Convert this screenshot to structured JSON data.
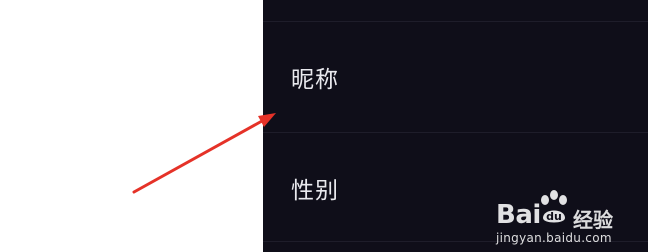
{
  "settings": {
    "rows": [
      {
        "label": "昵称"
      },
      {
        "label": "性别"
      }
    ]
  },
  "watermark": {
    "brand_left": "Bai",
    "brand_right": "du",
    "brand_cn": "经验",
    "url": "jingyan.baidu.com"
  },
  "annotation": {
    "arrow_color": "#e53228"
  },
  "colors": {
    "panel_bg": "#0f0e19",
    "divider": "#1e1d2a",
    "label_text": "#e9e9ee",
    "page_bg": "#ffffff"
  }
}
